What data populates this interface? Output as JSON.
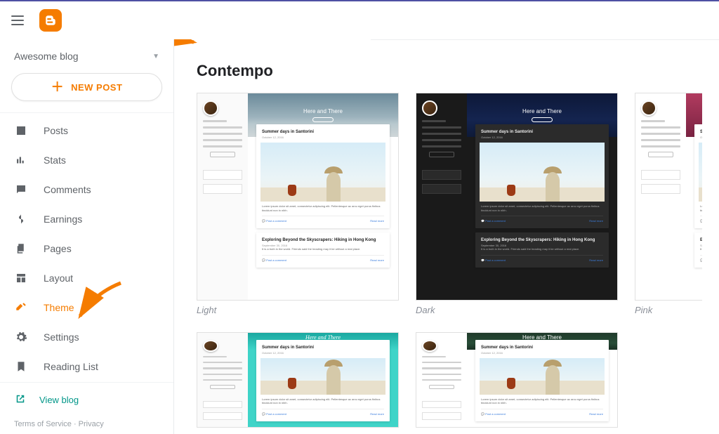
{
  "app": {
    "blog_name": "Awesome blog",
    "new_post": "NEW POST",
    "view_blog": "View blog",
    "footer": "Terms of Service · Privacy"
  },
  "sidebar": {
    "items": [
      {
        "id": "posts",
        "label": "Posts"
      },
      {
        "id": "stats",
        "label": "Stats"
      },
      {
        "id": "comments",
        "label": "Comments"
      },
      {
        "id": "earnings",
        "label": "Earnings"
      },
      {
        "id": "pages",
        "label": "Pages"
      },
      {
        "id": "layout",
        "label": "Layout"
      },
      {
        "id": "theme",
        "label": "Theme"
      },
      {
        "id": "settings",
        "label": "Settings"
      },
      {
        "id": "reading-list",
        "label": "Reading List"
      }
    ]
  },
  "main": {
    "section_title": "Contempo",
    "preview_hero_title": "Here and There",
    "post1_title": "Summer days in Santorini",
    "post2_title": "Exploring Beyond the Skyscrapers: Hiking in Hong Kong",
    "themes": [
      {
        "id": "light",
        "label": "Light",
        "hero": "hero-sea",
        "variant": ""
      },
      {
        "id": "dark",
        "label": "Dark",
        "hero": "hero-night",
        "variant": "bg-dark"
      },
      {
        "id": "pink",
        "label": "Pink",
        "hero": "hero-pink",
        "variant": "bg-pink",
        "cut": true
      },
      {
        "id": "teal",
        "label": "",
        "hero": "hero-teal",
        "variant": "bg-teal",
        "row2": true
      },
      {
        "id": "leaf",
        "label": "",
        "hero": "hero-leaf",
        "variant": "bg-leaf",
        "row2": true
      }
    ]
  }
}
